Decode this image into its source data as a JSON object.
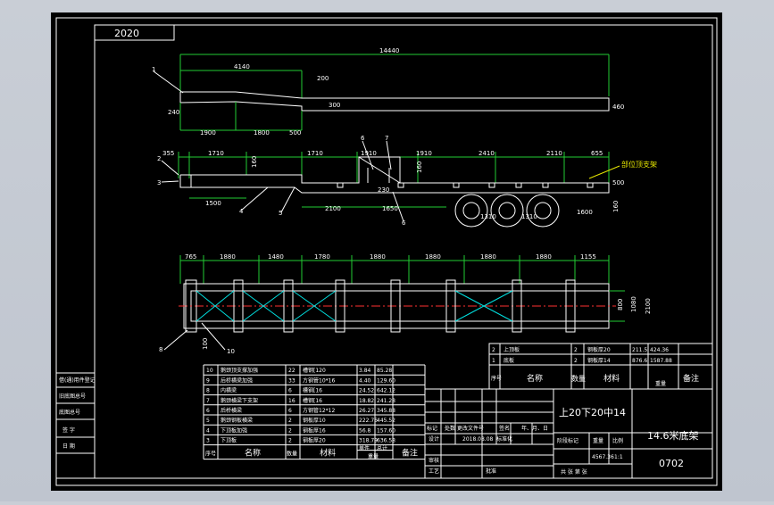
{
  "drawing": {
    "corner_tag": "2020",
    "overall_length": "14440",
    "upper_dims": [
      "4140",
      "200",
      "300",
      "240",
      "1900",
      "1800",
      "500",
      "460"
    ],
    "side_dims": [
      "355",
      "1710",
      "1710",
      "1910",
      "1910",
      "2410",
      "2110",
      "655"
    ],
    "side_misc": [
      "160",
      "160",
      "1500",
      "230",
      "1650",
      "2100",
      "1310",
      "1310",
      "1600",
      "500",
      "160"
    ],
    "plan_dims": [
      "765",
      "1880",
      "1480",
      "1780",
      "1880",
      "1880",
      "1880",
      "1880",
      "1155"
    ],
    "plan_misc": [
      "800",
      "1080",
      "2100",
      "100"
    ],
    "callouts": [
      "1",
      "2",
      "3",
      "4",
      "5",
      "6",
      "7",
      "8",
      "9",
      "10"
    ],
    "annotation": "部位顶支架"
  },
  "bom_top": {
    "rows": [
      {
        "no": "2",
        "name": "上顶板",
        "qty": "2",
        "material": "钢板厚20",
        "w1": "211.5",
        "w2": "424.36"
      },
      {
        "no": "1",
        "name": "底板",
        "qty": "2",
        "material": "钢板厚14",
        "w1": "876.6",
        "w2": "1587.88"
      }
    ],
    "header": {
      "no": "序号",
      "name": "名称",
      "qty": "数量",
      "material": "材料",
      "weight": "重量",
      "remark": "备注"
    }
  },
  "bom_bottom": {
    "rows": [
      {
        "no": "10",
        "name": "鹅颈顶支撑加强",
        "qty": "22",
        "material": "槽钢[120",
        "w1": "3.84",
        "w2": "85.28"
      },
      {
        "no": "9",
        "name": "后桥横梁加强",
        "qty": "33",
        "material": "方钢管10*16",
        "w1": "4.40",
        "w2": "129.60"
      },
      {
        "no": "8",
        "name": "内横梁",
        "qty": "6",
        "material": "槽钢[16",
        "w1": "24.52",
        "w2": "642.12"
      },
      {
        "no": "7",
        "name": "鹅颈横梁下支架",
        "qty": "16",
        "material": "槽钢[16",
        "w1": "18.82",
        "w2": "241.28"
      },
      {
        "no": "6",
        "name": "后桥横梁",
        "qty": "6",
        "material": "方钢管12*12",
        "w1": "26.27",
        "w2": "345.88"
      },
      {
        "no": "5",
        "name": "鹅颈钢板横梁",
        "qty": "2",
        "material": "钢板厚10",
        "w1": "222.76",
        "w2": "445.52"
      },
      {
        "no": "4",
        "name": "下顶板加强",
        "qty": "2",
        "material": "钢板厚16",
        "w1": "56.8",
        "w2": "157.60"
      },
      {
        "no": "3",
        "name": "下顶板",
        "qty": "2",
        "material": "钢板厚20",
        "w1": "318.79",
        "w2": "636.58"
      }
    ],
    "header": {
      "no": "序号",
      "name": "名称",
      "qty": "数量",
      "material": "材料",
      "single": "单件",
      "total": "总计",
      "weight": "重量",
      "remark": "备注"
    }
  },
  "title_block": {
    "spec": "上20下20中14",
    "title": "14.6米底架",
    "drawing_no": "0702",
    "scale": "1:1",
    "weight": "4567.36",
    "stage_label": "阶段标记",
    "weight_label": "重量",
    "scale_label": "比例",
    "sheet_label": "共 张 第 张",
    "mark_row": [
      "标记",
      "处数",
      "更改文件号",
      "签名",
      "年、月、日"
    ],
    "design": "设计",
    "design_info": "2018.08.08",
    "std": "标准化",
    "review": "审核",
    "craft": "工艺",
    "approve": "批准"
  },
  "left_strip": [
    "借(通)用件登记",
    "旧底图总号",
    "底图总号",
    "签 字",
    "日 期"
  ]
}
